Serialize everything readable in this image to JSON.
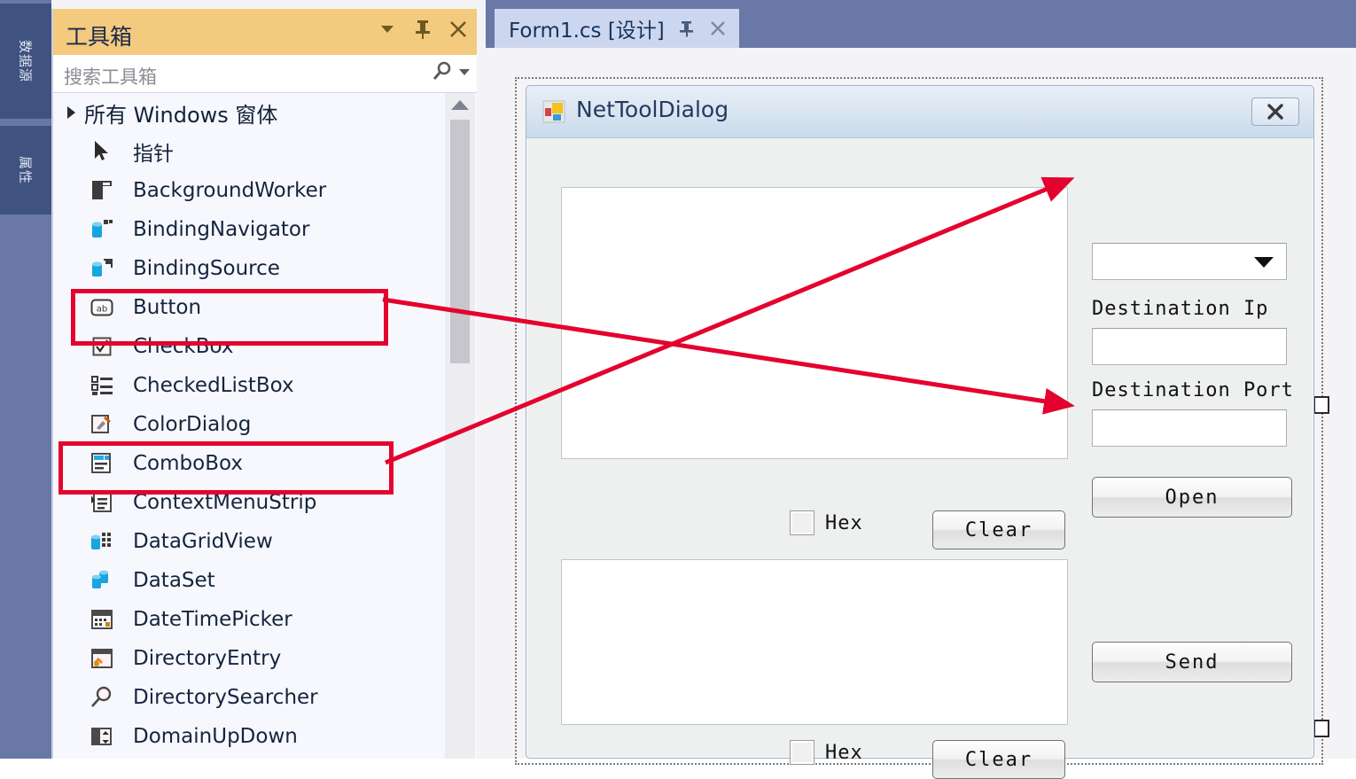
{
  "shell": {
    "vertical_tabs": [
      {
        "label": "数据源",
        "name": "data-sources"
      },
      {
        "label": "属性",
        "name": "properties"
      }
    ]
  },
  "toolbox": {
    "title": "工具箱",
    "header_buttons": [
      {
        "label": "▾",
        "icon": "chevron-down-icon"
      },
      {
        "label": "⚲",
        "icon": "pin-icon"
      },
      {
        "label": "✕",
        "icon": "close-icon"
      }
    ],
    "search": {
      "placeholder": "搜索工具箱",
      "icon": "search-icon",
      "dropdown_icon": "chevron-down-icon"
    },
    "group": {
      "label": "所有 Windows 窗体",
      "expanded": true
    },
    "items": [
      {
        "label": "指针",
        "icon": "pointer-icon"
      },
      {
        "label": "BackgroundWorker",
        "icon": "backgroundworker-icon"
      },
      {
        "label": "BindingNavigator",
        "icon": "bindingnavigator-icon"
      },
      {
        "label": "BindingSource",
        "icon": "bindingsource-icon"
      },
      {
        "label": "Button",
        "icon": "button-icon"
      },
      {
        "label": "CheckBox",
        "icon": "checkbox-icon"
      },
      {
        "label": "CheckedListBox",
        "icon": "checkedlistbox-icon"
      },
      {
        "label": "ColorDialog",
        "icon": "colordialog-icon"
      },
      {
        "label": "ComboBox",
        "icon": "combobox-icon"
      },
      {
        "label": "ContextMenuStrip",
        "icon": "contextmenustrip-icon"
      },
      {
        "label": "DataGridView",
        "icon": "datagridview-icon"
      },
      {
        "label": "DataSet",
        "icon": "dataset-icon"
      },
      {
        "label": "DateTimePicker",
        "icon": "datetimepicker-icon"
      },
      {
        "label": "DirectoryEntry",
        "icon": "directoryentry-icon"
      },
      {
        "label": "DirectorySearcher",
        "icon": "directorysearcher-icon"
      },
      {
        "label": "DomainUpDown",
        "icon": "domainupdown-icon"
      }
    ]
  },
  "designer": {
    "tab": {
      "label": "Form1.cs [设计]",
      "pin_icon": "pin-icon",
      "close_icon": "close-icon"
    },
    "form": {
      "title": "NetToolDialog",
      "icon": "winform-icon",
      "close_label": "✕",
      "combo": {
        "value": "",
        "arrow_icon": "chevron-down-icon"
      },
      "labels": {
        "destination_ip": "Destination Ip",
        "destination_port": "Destination Port"
      },
      "fields": {
        "destination_ip_value": "",
        "destination_port_value": ""
      },
      "buttons": {
        "open": "Open",
        "send": "Send",
        "clear_top": "Clear",
        "clear_bottom": "Clear"
      },
      "checkboxes": {
        "hex_top": "Hex",
        "hex_bottom": "Hex"
      },
      "receive_box_value": "",
      "send_box_value": ""
    }
  },
  "annotations": {
    "accent_color": "#e4032e",
    "highlights": [
      {
        "target": "Button"
      },
      {
        "target": "ComboBox"
      }
    ],
    "arrows": [
      {
        "from": "Button",
        "to": "Open"
      },
      {
        "from": "ComboBox",
        "to": "ComboBox control"
      }
    ]
  }
}
